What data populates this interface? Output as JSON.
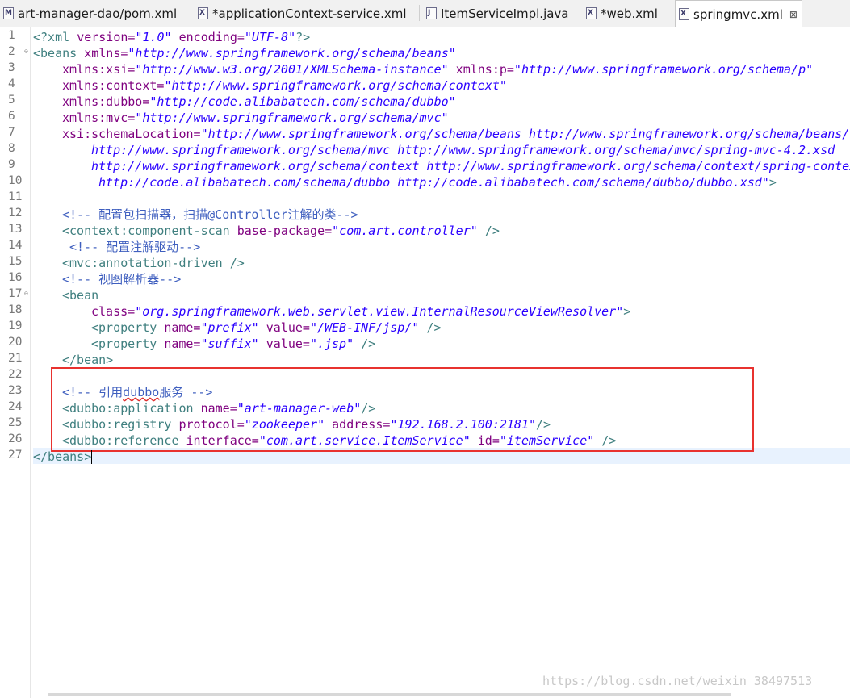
{
  "tabs": [
    {
      "label": "art-manager-dao/pom.xml",
      "icon": "M"
    },
    {
      "label": "*applicationContext-service.xml",
      "icon": "X"
    },
    {
      "label": "ItemServiceImpl.java",
      "icon": "J"
    },
    {
      "label": "*web.xml",
      "icon": "X"
    },
    {
      "label": "springmvc.xml",
      "icon": "X",
      "close": "⊠"
    }
  ],
  "lines": [
    "1",
    "2",
    "3",
    "4",
    "5",
    "6",
    "7",
    "8",
    "9",
    "10",
    "11",
    "12",
    "13",
    "14",
    "15",
    "16",
    "17",
    "18",
    "19",
    "20",
    "21",
    "22",
    "23",
    "24",
    "25",
    "26",
    "27"
  ],
  "code": {
    "l1": {
      "a": "<?xml ",
      "b": "version=",
      "c": "\"1.0\"",
      "d": " encoding=",
      "e": "\"UTF-8\"",
      "f": "?>"
    },
    "l2": {
      "a": "<beans ",
      "b": "xmlns=",
      "c": "\"http://www.springframework.org/schema/beans\""
    },
    "l3": {
      "b": "xmlns:xsi=",
      "c": "\"http://www.w3.org/2001/XMLSchema-instance\"",
      "d": " xmlns:p=",
      "e": "\"http://www.springframework.org/schema/p\""
    },
    "l4": {
      "b": "xmlns:context=",
      "c": "\"http://www.springframework.org/schema/context\""
    },
    "l5": {
      "b": "xmlns:dubbo=",
      "c": "\"http://code.alibabatech.com/schema/dubbo\""
    },
    "l6": {
      "b": "xmlns:mvc=",
      "c": "\"http://www.springframework.org/schema/mvc\""
    },
    "l7": {
      "b": "xsi:schemaLocation=",
      "c": "\"http://www.springframework.org/schema/beans http://www.springframework.org/schema/beans/s"
    },
    "l8": {
      "c": "http://www.springframework.org/schema/mvc http://www.springframework.org/schema/mvc/spring-mvc-4.2.xsd"
    },
    "l9": {
      "c": "http://www.springframework.org/schema/context http://www.springframework.org/schema/context/spring-contex"
    },
    "l10": {
      "c": "http://code.alibabatech.com/schema/dubbo http://code.alibabatech.com/schema/dubbo/dubbo.xsd\"",
      "f": ">"
    },
    "l12": {
      "c": "<!-- 配置包扫描器，扫描@Controller注解的类-->"
    },
    "l13": {
      "a": "<context:component-scan ",
      "b": "base-package=",
      "c": "\"com.art.controller\"",
      "f": " />"
    },
    "l14": {
      "c": "<!-- 配置注解驱动-->"
    },
    "l15": {
      "a": "<mvc:annotation-driven ",
      "f": "/>"
    },
    "l16": {
      "c": "<!-- 视图解析器-->"
    },
    "l17": {
      "a": "<bean"
    },
    "l18": {
      "b": "class=",
      "c": "\"org.springframework.web.servlet.view.InternalResourceViewResolver\"",
      "f": ">"
    },
    "l19": {
      "a": "<property ",
      "b": "name=",
      "c": "\"prefix\"",
      "d": " value=",
      "e": "\"/WEB-INF/jsp/\"",
      "f": " />"
    },
    "l20": {
      "a": "<property ",
      "b": "name=",
      "c": "\"suffix\"",
      "d": " value=",
      "e": "\".jsp\"",
      "f": " />"
    },
    "l21": {
      "a": "</bean>"
    },
    "l23": {
      "a": "<!-- 引用",
      "b": "dubbo",
      "c": "服务 -->"
    },
    "l24": {
      "a": "<dubbo:application ",
      "b": "name=",
      "c": "\"art-manager-web\"",
      "f": "/>"
    },
    "l25": {
      "a": "<dubbo:registry ",
      "b": "protocol=",
      "c": "\"zookeeper\"",
      "d": " address=",
      "e": "\"192.168.2.100:2181\"",
      "f": "/>"
    },
    "l26": {
      "a": "<dubbo:reference ",
      "b": "interface=",
      "c": "\"com.art.service.ItemService\"",
      "d": " id=",
      "e": "\"itemService\"",
      "f": " />"
    },
    "l27": {
      "a": "</beans>"
    }
  },
  "watermark": "https://blog.csdn.net/weixin_38497513",
  "colors": {
    "tag": "#3f7f7f",
    "attr": "#7f007f",
    "value": "#2a00ff",
    "comment": "#3f5fbf",
    "highlight_box": "#e8322f",
    "current_line": "#e8f2fe"
  }
}
